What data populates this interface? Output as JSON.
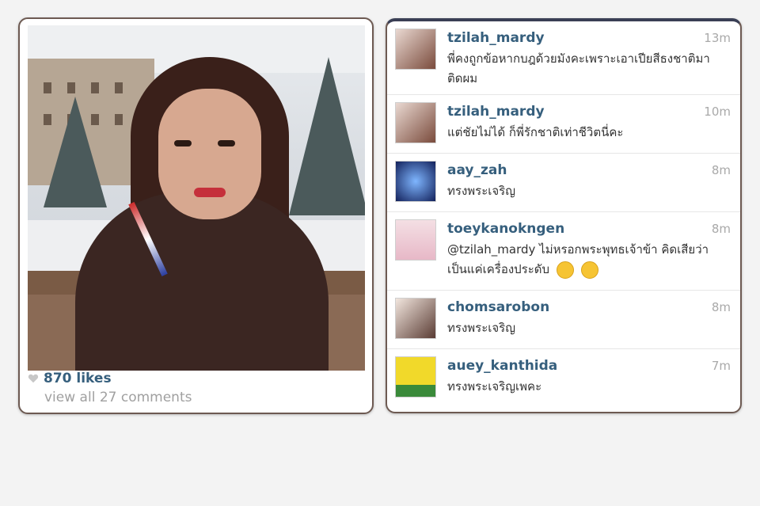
{
  "post": {
    "likes": "870 likes",
    "view_comments": "view all 27 comments"
  },
  "comments": [
    {
      "user": "tzilah_mardy",
      "time": "13m",
      "text": "พี่คงถูกข้อหากบฎด้วยมังคะเพราะเอาเปียสีธงชาติมาติดผม"
    },
    {
      "user": "tzilah_mardy",
      "time": "10m",
      "text": "แต่ชัยไม่ได้ ก็พี่รักชาติเท่าชีวิตนี่คะ"
    },
    {
      "user": "aay_zah",
      "time": "8m",
      "text": "ทรงพระเจริญ"
    },
    {
      "user": "toeykanokngen",
      "time": "8m",
      "text": "@tzilah_mardy ไม่หรอกพระพุทธเจ้าข้า คิดเสียว่าเป็นแค่เครื่องประดับ"
    },
    {
      "user": "chomsarobon",
      "time": "8m",
      "text": "ทรงพระเจริญ"
    },
    {
      "user": "auey_kanthida",
      "time": "7m",
      "text": "ทรงพระเจริญเพคะ"
    }
  ],
  "colors": {
    "username": "#365f7d",
    "timestamp": "#a9a9a9",
    "border": "#6d5a52"
  },
  "icons": {
    "likes": "heart-icon",
    "emoji": "smiley-emoji-icon"
  }
}
